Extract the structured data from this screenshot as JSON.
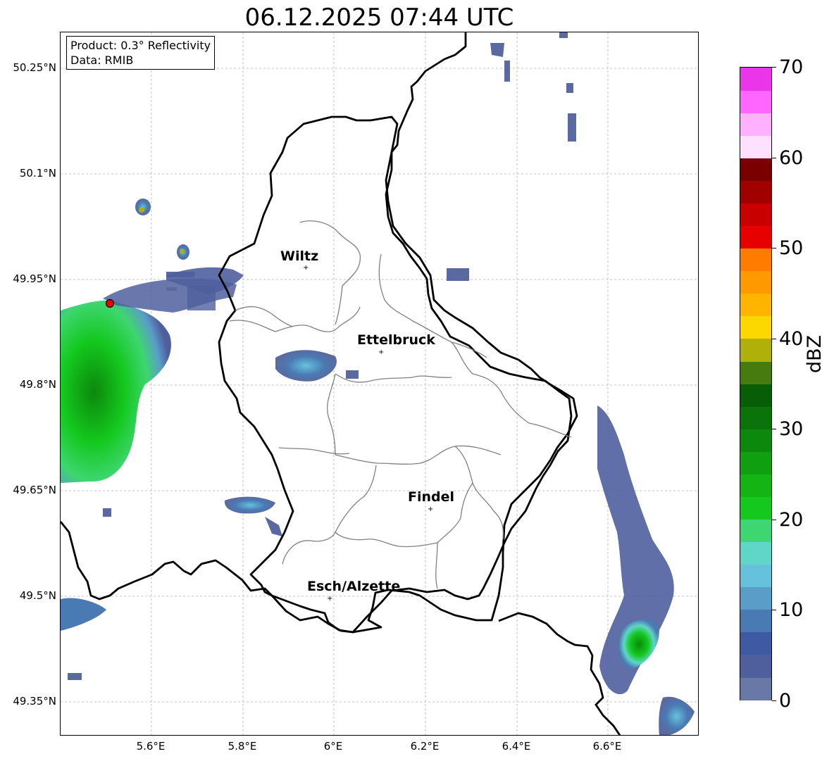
{
  "title": "06.12.2025 07:44 UTC",
  "info_box": {
    "product": "Product: 0.3° Reflectivity",
    "data": "Data: RMIB"
  },
  "lat_labels": [
    "50.25°N",
    "50.1°N",
    "49.95°N",
    "49.8°N",
    "49.65°N",
    "49.5°N",
    "49.35°N"
  ],
  "lon_labels": [
    "5.6°E",
    "5.8°E",
    "6°E",
    "6.2°E",
    "6.4°E",
    "6.6°E"
  ],
  "cities": [
    {
      "name": "Wiltz",
      "lon": 5.93,
      "lat": 49.965
    },
    {
      "name": "Ettelbruck",
      "lon": 6.1,
      "lat": 49.85
    },
    {
      "name": "Findel",
      "lon": 6.21,
      "lat": 49.628
    },
    {
      "name": "Esch/Alzette",
      "lon": 5.99,
      "lat": 49.5
    }
  ],
  "colorbar": {
    "label": "dBZ",
    "tick_labels": [
      "0",
      "10",
      "20",
      "30",
      "40",
      "50",
      "60",
      "70"
    ],
    "colors": [
      "#6a78a8",
      "#4f5f9e",
      "#3f5aa3",
      "#4a7ab3",
      "#5a9dc8",
      "#66c2dc",
      "#5fd6c8",
      "#3ed670",
      "#14c81e",
      "#14b414",
      "#0f9f0f",
      "#0c880c",
      "#0a730a",
      "#075e07",
      "#477a0f",
      "#b0b00a",
      "#ffd700",
      "#ffb400",
      "#ff9900",
      "#ff7c00",
      "#e60000",
      "#c80000",
      "#a00000",
      "#7a0000",
      "#ffe0ff",
      "#ffb0ff",
      "#ff66ff",
      "#ea35ea"
    ]
  },
  "colors": {
    "border": "#000000",
    "canton": "#808080",
    "grid": "#b0b0b0",
    "radar_site": "#ee0000"
  }
}
